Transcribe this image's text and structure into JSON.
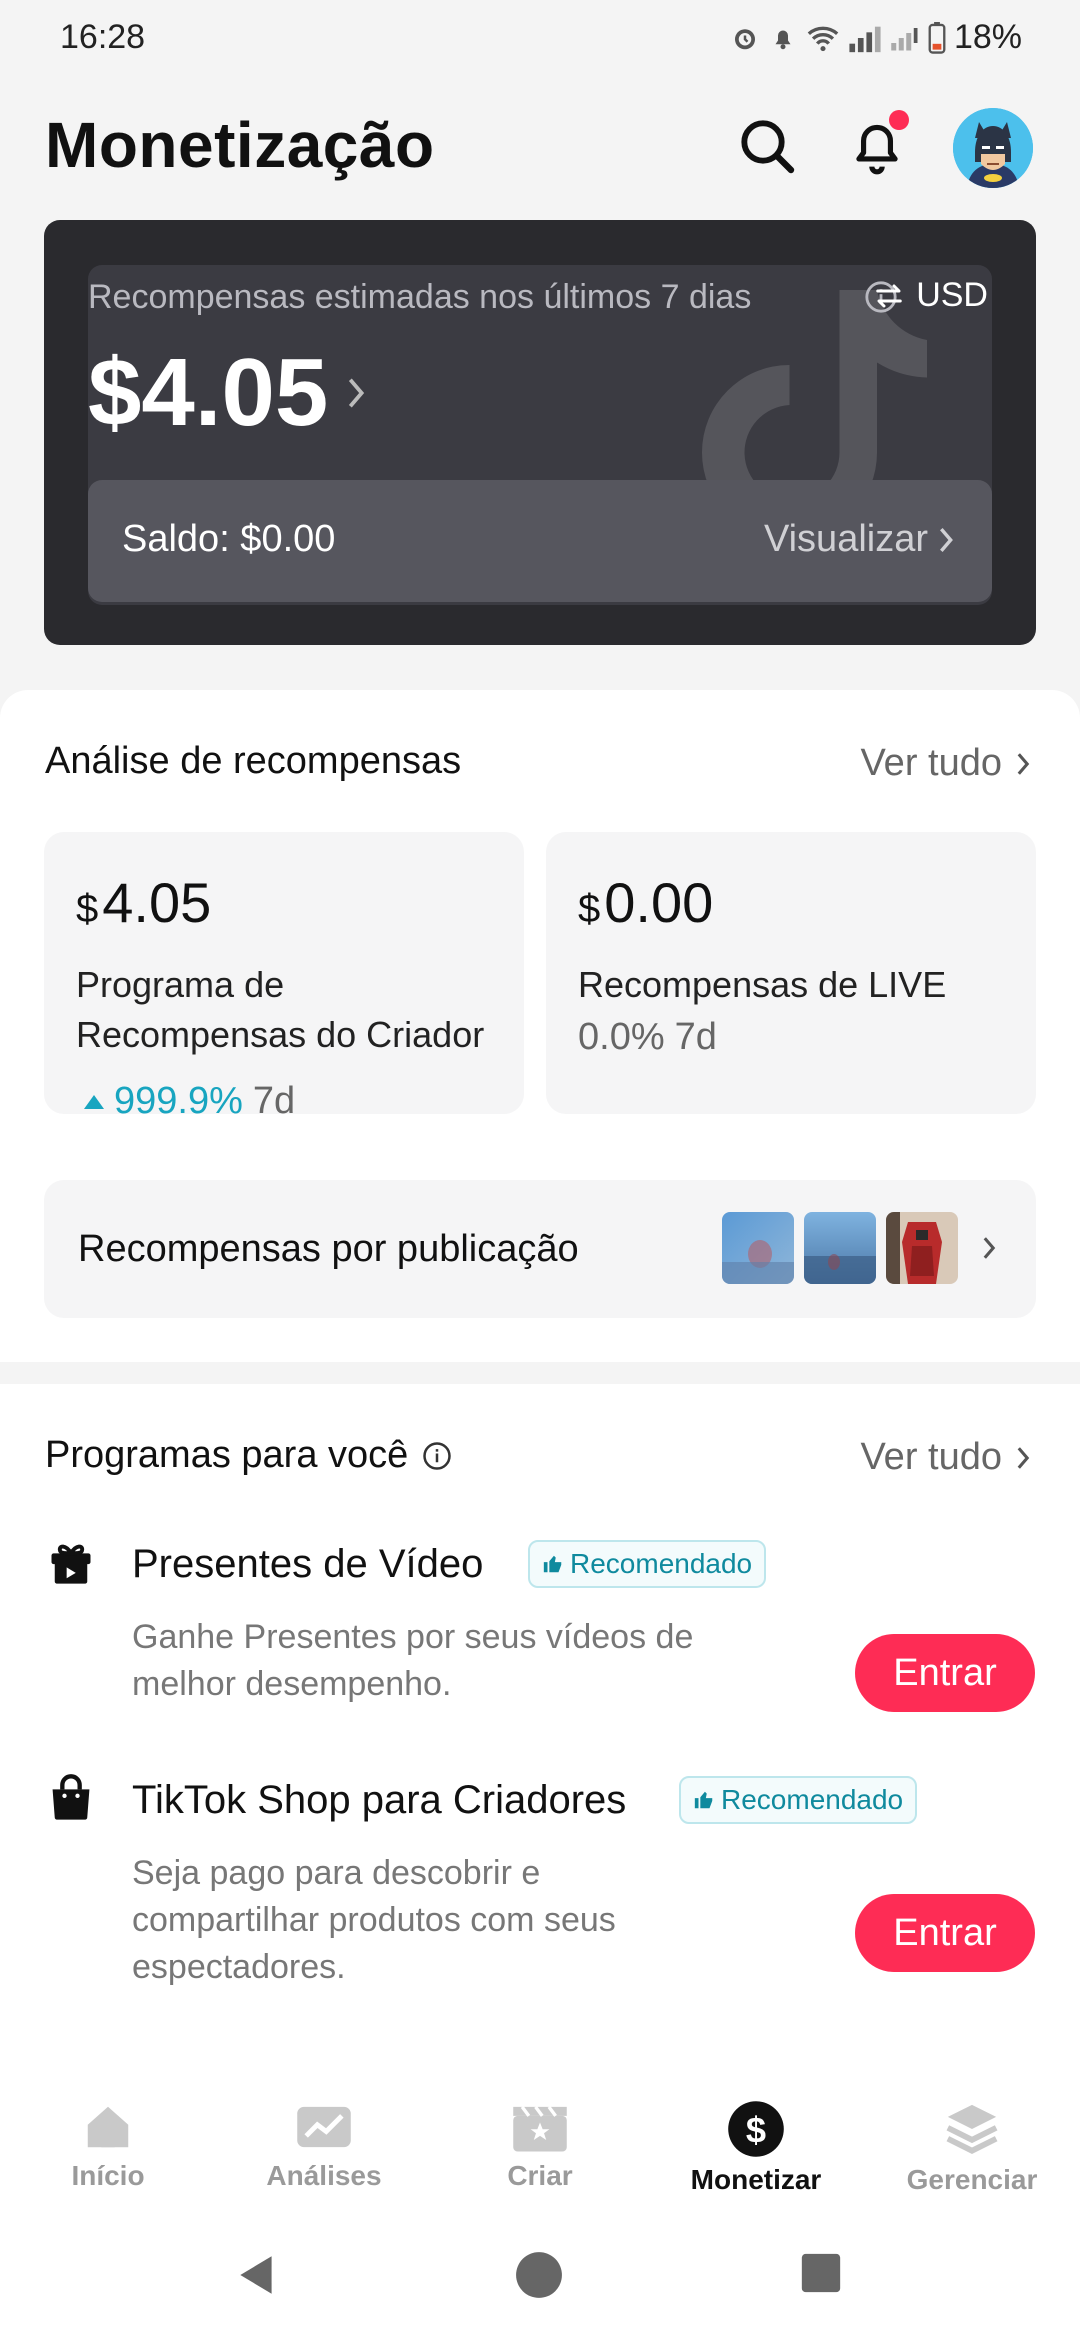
{
  "status": {
    "time": "16:28",
    "battery": "18%"
  },
  "header": {
    "title": "Monetização"
  },
  "earnings": {
    "label": "Recompensas estimadas nos últimos 7 dias",
    "currency": "USD",
    "amount": "$4.05",
    "balance": "Saldo: $0.00",
    "view": "Visualizar"
  },
  "analysis": {
    "title": "Análise de recompensas",
    "see_all": "Ver tudo",
    "cards": [
      {
        "currency": "$",
        "value": "4.05",
        "name_line1": "Programa de",
        "name_line2": "Recompensas do Criador",
        "growth": "999.9%",
        "period": "7d"
      },
      {
        "currency": "$",
        "value": "0.00",
        "name_line1": "Recompensas de LIVE",
        "growth": "0.0%",
        "period": "7d"
      }
    ],
    "per_post": "Recompensas por publicação"
  },
  "programs": {
    "title": "Programas para você",
    "see_all": "Ver tudo",
    "items": [
      {
        "title": "Presentes de Vídeo",
        "badge": "Recomendado",
        "desc_line1": "Ganhe Presentes por seus vídeos de",
        "desc_line2": "melhor desempenho.",
        "action": "Entrar",
        "icon": "gift-icon"
      },
      {
        "title": "TikTok Shop para Criadores",
        "badge": "Recomendado",
        "desc_line1": "Seja pago para descobrir e",
        "desc_line2": "compartilhar produtos com seus",
        "desc_line3": "espectadores.",
        "action": "Entrar",
        "icon": "shopping-bag-icon"
      }
    ]
  },
  "nav": {
    "items": [
      {
        "label": "Início",
        "icon": "home-icon"
      },
      {
        "label": "Análises",
        "icon": "analytics-icon"
      },
      {
        "label": "Criar",
        "icon": "create-icon"
      },
      {
        "label": "Monetizar",
        "icon": "dollar-icon",
        "active": true
      },
      {
        "label": "Gerenciar",
        "icon": "layers-icon"
      }
    ]
  },
  "colors": {
    "accent": "#fe2c55",
    "growth": "#18a5c0",
    "card_dark": "#2a2a2e"
  }
}
